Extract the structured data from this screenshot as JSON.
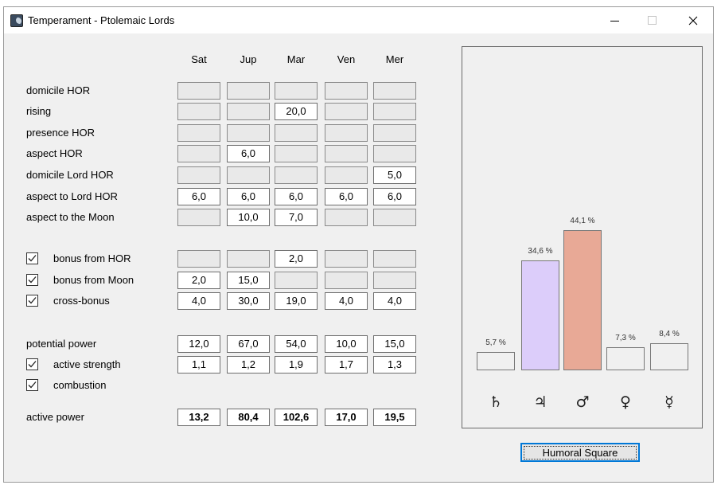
{
  "window": {
    "title": "Temperament - Ptolemaic Lords",
    "minimize_glyph": "—",
    "maximize_glyph": "☐",
    "close_glyph": "✕"
  },
  "columns": [
    "Sat",
    "Jup",
    "Mar",
    "Ven",
    "Mer"
  ],
  "rows": [
    {
      "label": "domicile HOR",
      "values": [
        "",
        "",
        "",
        "",
        ""
      ]
    },
    {
      "label": "rising",
      "values": [
        "",
        "",
        "20,0",
        "",
        ""
      ]
    },
    {
      "label": "presence HOR",
      "values": [
        "",
        "",
        "",
        "",
        ""
      ]
    },
    {
      "label": "aspect HOR",
      "values": [
        "",
        "6,0",
        "",
        "",
        ""
      ]
    },
    {
      "label": "domicile Lord HOR",
      "values": [
        "",
        "",
        "",
        "",
        "5,0"
      ]
    },
    {
      "label": "aspect to Lord HOR",
      "values": [
        "6,0",
        "6,0",
        "6,0",
        "6,0",
        "6,0"
      ]
    },
    {
      "label": "aspect to the Moon",
      "values": [
        "",
        "10,0",
        "7,0",
        "",
        ""
      ]
    },
    {
      "label": "bonus from HOR",
      "checked": true,
      "values": [
        "",
        "",
        "2,0",
        "",
        ""
      ]
    },
    {
      "label": "bonus from Moon",
      "checked": true,
      "values": [
        "2,0",
        "15,0",
        "",
        "",
        ""
      ]
    },
    {
      "label": "cross-bonus",
      "checked": true,
      "values": [
        "4,0",
        "30,0",
        "19,0",
        "4,0",
        "4,0"
      ]
    },
    {
      "label": "potential power",
      "values": [
        "12,0",
        "67,0",
        "54,0",
        "10,0",
        "15,0"
      ]
    },
    {
      "label": "active strength",
      "checked": true,
      "values": [
        "1,1",
        "1,2",
        "1,9",
        "1,7",
        "1,3"
      ]
    },
    {
      "label": "combustion",
      "checked": true
    },
    {
      "label": "active power",
      "values": [
        "13,2",
        "80,4",
        "102,6",
        "17,0",
        "19,5"
      ]
    }
  ],
  "chart": {
    "bars": [
      {
        "planet": "Saturn",
        "symbol": "♄",
        "percent_label": "5,7 %",
        "percent": 5.7,
        "color": "#f0f0f0"
      },
      {
        "planet": "Jupiter",
        "symbol": "♃",
        "percent_label": "34,6 %",
        "percent": 34.6,
        "color": "#dccdfa"
      },
      {
        "planet": "Mars",
        "symbol": "♂",
        "percent_label": "44,1 %",
        "percent": 44.1,
        "color": "#e8a996"
      },
      {
        "planet": "Venus",
        "symbol": "♀",
        "percent_label": "7,3 %",
        "percent": 7.3,
        "color": "#f0f0f0"
      },
      {
        "planet": "Mercury",
        "symbol": "☿",
        "percent_label": "8,4 %",
        "percent": 8.4,
        "color": "#f0f0f0"
      }
    ]
  },
  "humoral_button": "Humoral Square"
}
